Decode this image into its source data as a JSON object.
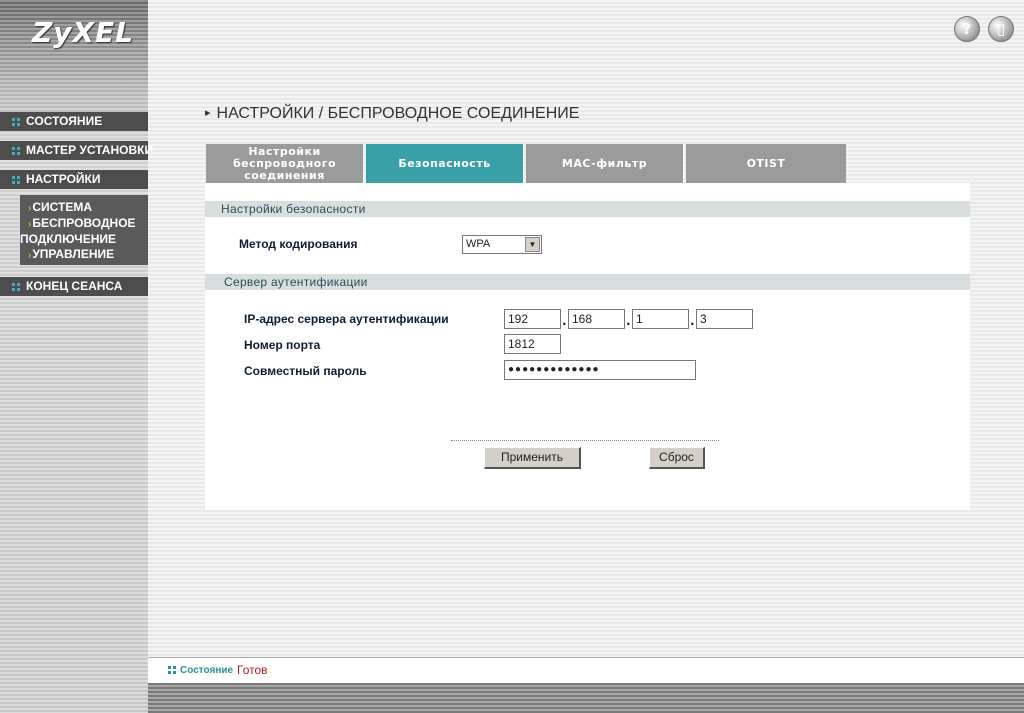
{
  "brand": {
    "logo": "ZyXEL"
  },
  "header": {
    "help_icon": "help-icon",
    "manual_icon": "manual-icon",
    "help_glyph": "?",
    "manual_glyph": "▯"
  },
  "sidebar": {
    "items": [
      {
        "label": "СОСТОЯНИЕ"
      },
      {
        "label": "МАСТЕР УСТАНОВКИ"
      },
      {
        "label": "НАСТРОЙКИ"
      },
      {
        "label": "КОНЕЦ СЕАНСА"
      }
    ],
    "submenu": [
      {
        "label": "СИСТЕМА"
      },
      {
        "label": "БЕСПРОВОДНОЕ"
      },
      {
        "label": "ПОДКЛЮЧЕНИЕ"
      },
      {
        "label": "УПРАВЛЕНИЕ"
      }
    ]
  },
  "page": {
    "title": "НАСТРОЙКИ / БЕСПРОВОДНОЕ СОЕДИНЕНИЕ"
  },
  "tabs": [
    {
      "label_lines": [
        "Настройки",
        "беспроводного",
        "соединения"
      ]
    },
    {
      "label": "Безопасность"
    },
    {
      "label": "MAC-фильтр"
    },
    {
      "label": "OTIST"
    }
  ],
  "security": {
    "section_title": "Настройки безопасности",
    "encoding_label": "Метод кодирования",
    "encoding_value": "WPA"
  },
  "auth_server": {
    "section_title": "Сервер аутентификации",
    "ip_label": "IP-адрес сервера аутентификации",
    "ip": [
      "192",
      "168",
      "1",
      "3"
    ],
    "port_label": "Номер порта",
    "port": "1812",
    "password_label": "Совместный пароль",
    "password_mask": "●●●●●●●●●●●●●"
  },
  "actions": {
    "apply": "Применить",
    "reset": "Сброс"
  },
  "status": {
    "label": "Состояние",
    "value": "Готов"
  },
  "colors": {
    "accent": "#3aa0a8",
    "nav_bg": "#4d4d4d",
    "status_value": "#b02020"
  }
}
